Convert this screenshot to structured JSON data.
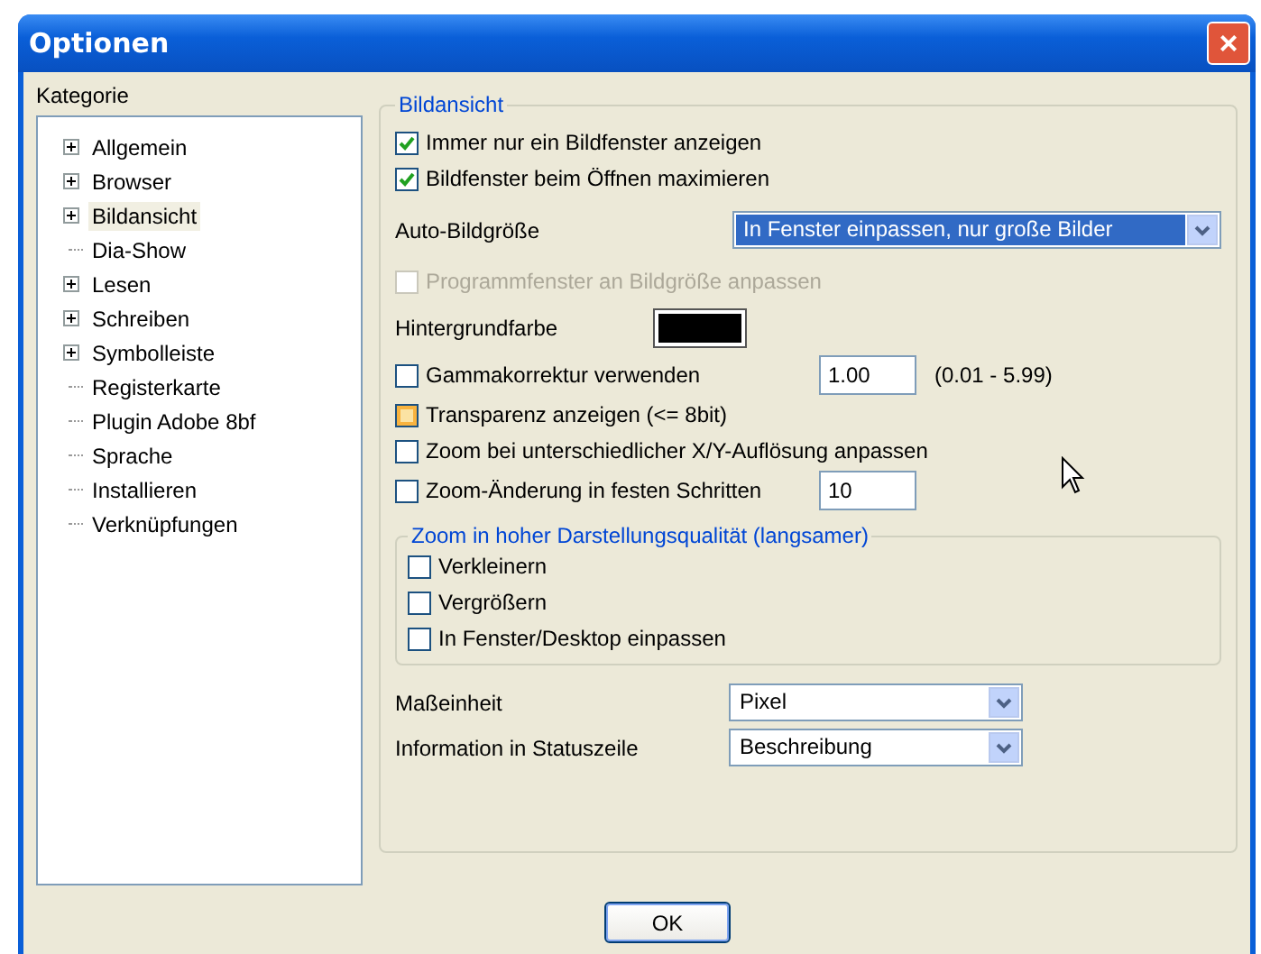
{
  "window": {
    "title": "Optionen",
    "close": "×"
  },
  "sidebar": {
    "label": "Kategorie",
    "items": [
      {
        "label": "Allgemein",
        "expandable": true,
        "selected": false
      },
      {
        "label": "Browser",
        "expandable": true,
        "selected": false
      },
      {
        "label": "Bildansicht",
        "expandable": true,
        "selected": true
      },
      {
        "label": "Dia-Show",
        "expandable": false,
        "selected": false
      },
      {
        "label": "Lesen",
        "expandable": true,
        "selected": false
      },
      {
        "label": "Schreiben",
        "expandable": true,
        "selected": false
      },
      {
        "label": "Symbolleiste",
        "expandable": true,
        "selected": false
      },
      {
        "label": "Registerkarte",
        "expandable": false,
        "selected": false
      },
      {
        "label": "Plugin Adobe 8bf",
        "expandable": false,
        "selected": false
      },
      {
        "label": "Sprache",
        "expandable": false,
        "selected": false
      },
      {
        "label": "Installieren",
        "expandable": false,
        "selected": false
      },
      {
        "label": "Verknüpfungen",
        "expandable": false,
        "selected": false
      }
    ]
  },
  "group": {
    "title": "Bildansicht",
    "rows": [
      {
        "kind": "checkbox",
        "label": "Immer nur ein Bildfenster anzeigen",
        "checked": true,
        "disabled": false
      },
      {
        "kind": "checkbox",
        "label": "Bildfenster beim Öffnen maximieren",
        "checked": true,
        "disabled": false
      },
      {
        "kind": "select",
        "label": "Auto-Bildgröße",
        "value": "In Fenster einpassen, nur große Bilder",
        "focused": true
      },
      {
        "kind": "checkbox",
        "label": "Programmfenster an Bildgröße anpassen",
        "checked": false,
        "disabled": true
      },
      {
        "kind": "color",
        "label": "Hintergrundfarbe",
        "color": "#000000"
      },
      {
        "kind": "checkbox_input",
        "label": "Gammakorrektur verwenden",
        "checked": false,
        "disabled": false,
        "value": "1.00",
        "note": "(0.01 - 5.99)"
      },
      {
        "kind": "checkbox",
        "label": "Transparenz anzeigen (<= 8bit)",
        "checked": false,
        "disabled": false,
        "hovered": true
      },
      {
        "kind": "checkbox",
        "label": "Zoom bei unterschiedlicher X/Y-Auflösung anpassen",
        "checked": false,
        "disabled": false
      },
      {
        "kind": "checkbox_input",
        "label": "Zoom-Änderung in festen Schritten",
        "checked": false,
        "disabled": false,
        "value": "10"
      },
      {
        "kind": "subgroup",
        "title": "Zoom in hoher Darstellungsqualität (langsamer)",
        "items": [
          {
            "label": "Verkleinern",
            "checked": false
          },
          {
            "label": "Vergrößern",
            "checked": false
          },
          {
            "label": "In Fenster/Desktop einpassen",
            "checked": false
          }
        ]
      },
      {
        "kind": "select",
        "label": "Maßeinheit",
        "value": "Pixel",
        "focused": false
      },
      {
        "kind": "select",
        "label": "Information in Statuszeile",
        "value": "Beschreibung",
        "focused": false
      }
    ]
  },
  "buttons": [
    "OK"
  ]
}
